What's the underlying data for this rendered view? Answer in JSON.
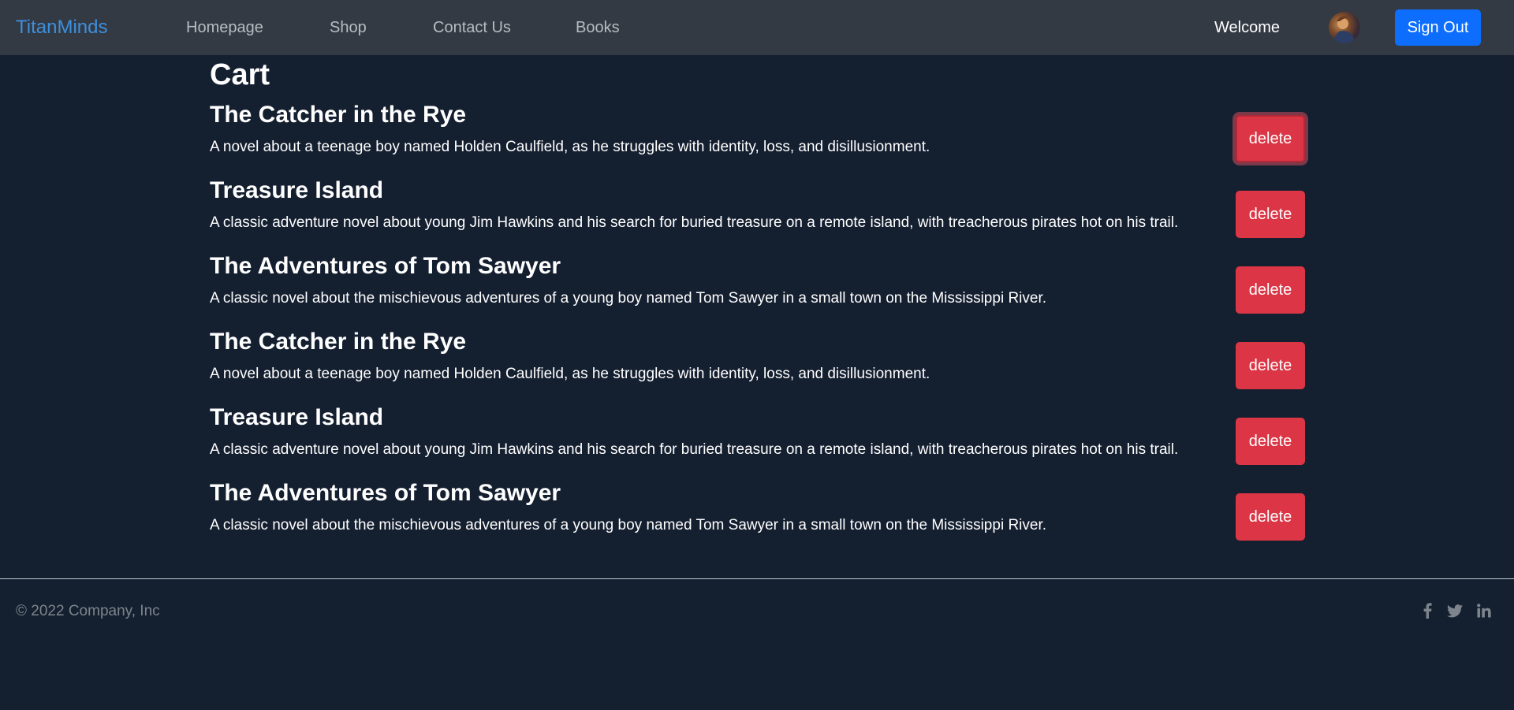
{
  "navbar": {
    "brand": "TitanMinds",
    "links": [
      "Homepage",
      "Shop",
      "Contact Us",
      "Books"
    ],
    "welcome": "Welcome",
    "sign_out": "Sign Out"
  },
  "cart": {
    "title": "Cart",
    "delete_label": "delete",
    "items": [
      {
        "title": "The Catcher in the Rye",
        "description": "A novel about a teenage boy named Holden Caulfield, as he struggles with identity, loss, and disillusionment."
      },
      {
        "title": "Treasure Island",
        "description": "A classic adventure novel about young Jim Hawkins and his search for buried treasure on a remote island, with treacherous pirates hot on his trail."
      },
      {
        "title": "The Adventures of Tom Sawyer",
        "description": "A classic novel about the mischievous adventures of a young boy named Tom Sawyer in a small town on the Mississippi River."
      },
      {
        "title": "The Catcher in the Rye",
        "description": "A novel about a teenage boy named Holden Caulfield, as he struggles with identity, loss, and disillusionment."
      },
      {
        "title": "Treasure Island",
        "description": "A classic adventure novel about young Jim Hawkins and his search for buried treasure on a remote island, with treacherous pirates hot on his trail."
      },
      {
        "title": "The Adventures of Tom Sawyer",
        "description": "A classic novel about the mischievous adventures of a young boy named Tom Sawyer in a small town on the Mississippi River."
      }
    ]
  },
  "footer": {
    "copyright": "© 2022 Company, Inc",
    "social_icons": [
      "facebook-icon",
      "twitter-icon",
      "linkedin-icon"
    ]
  },
  "colors": {
    "background": "#141f30",
    "navbar": "#343a44",
    "brand": "#3d8fdb",
    "primary": "#0d6efd",
    "danger": "#dc3545"
  }
}
